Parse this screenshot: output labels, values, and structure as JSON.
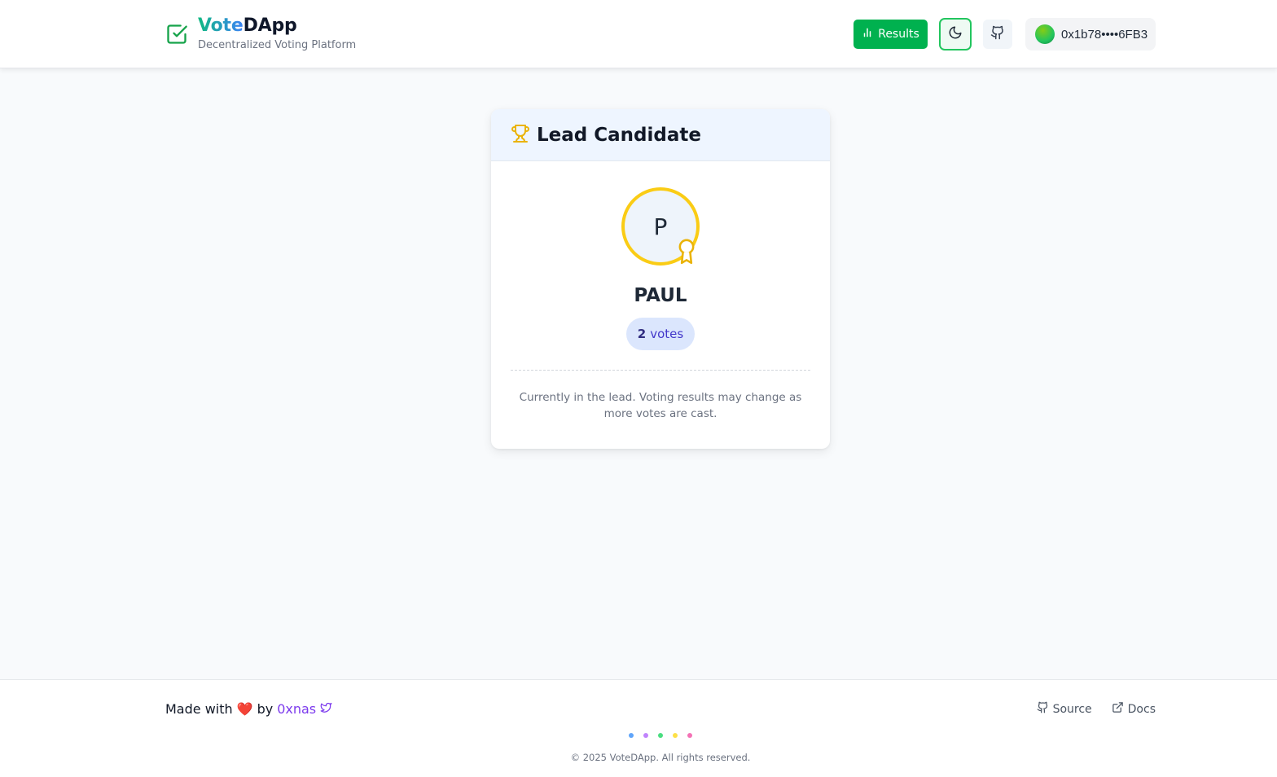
{
  "header": {
    "brand_vote": "Vote",
    "brand_dapp": "DApp",
    "subtitle": "Decentralized Voting Platform",
    "results_label": "Results",
    "wallet_address": "0x1b78••••6FB3"
  },
  "card": {
    "title": "Lead Candidate",
    "avatar_initial": "P",
    "candidate_name": "PAUL",
    "vote_count": "2",
    "vote_unit": "votes",
    "note": "Currently in the lead. Voting results may change as more votes are cast."
  },
  "footer": {
    "made_with": "Made with",
    "by": "by",
    "author": "0xnas",
    "source_label": "Source",
    "docs_label": "Docs",
    "copyright": "© 2025 VoteDApp. All rights reserved."
  },
  "colors": {
    "accent_green": "#00b14f",
    "lead_ring": "#facc15",
    "author_purple": "#7c3aed",
    "footer_dots": [
      "#60a5fa",
      "#c084fc",
      "#4ade80",
      "#fde047",
      "#f472b6"
    ]
  },
  "icons": [
    "check-square-icon",
    "bar-chart-icon",
    "moon-icon",
    "github-icon",
    "trophy-icon",
    "award-icon",
    "heart-icon",
    "bird-icon",
    "external-link-icon"
  ]
}
